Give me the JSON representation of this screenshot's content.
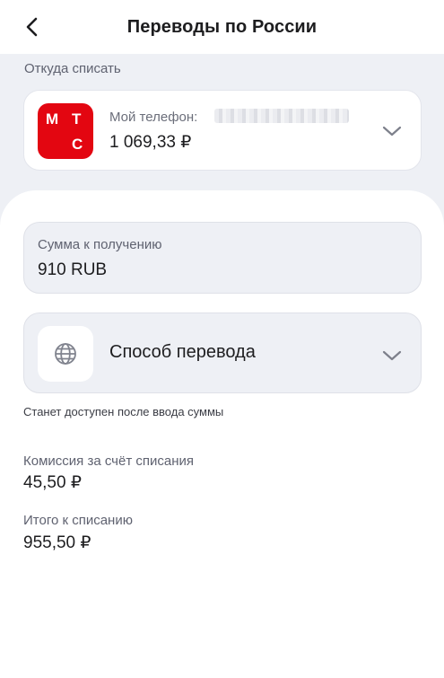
{
  "header": {
    "title": "Переводы по России",
    "back_icon": "chevron-left-icon"
  },
  "source": {
    "section_label": "Откуда списать",
    "logo": {
      "letters": [
        "М",
        "Т",
        "С"
      ],
      "color": "#e30611"
    },
    "phone_label": "Мой телефон:",
    "balance": "1 069,33 ₽",
    "expand_icon": "chevron-down-icon"
  },
  "amount": {
    "label": "Сумма к получению",
    "value": "910 RUB"
  },
  "method": {
    "label": "Способ перевода",
    "icon": "globe-icon",
    "expand_icon": "chevron-down-icon",
    "hint": "Станет доступен после ввода суммы"
  },
  "fee": {
    "label": "Комиссия за счёт списания",
    "value": "45,50 ₽"
  },
  "total": {
    "label": "Итого к списанию",
    "value": "955,50 ₽"
  }
}
